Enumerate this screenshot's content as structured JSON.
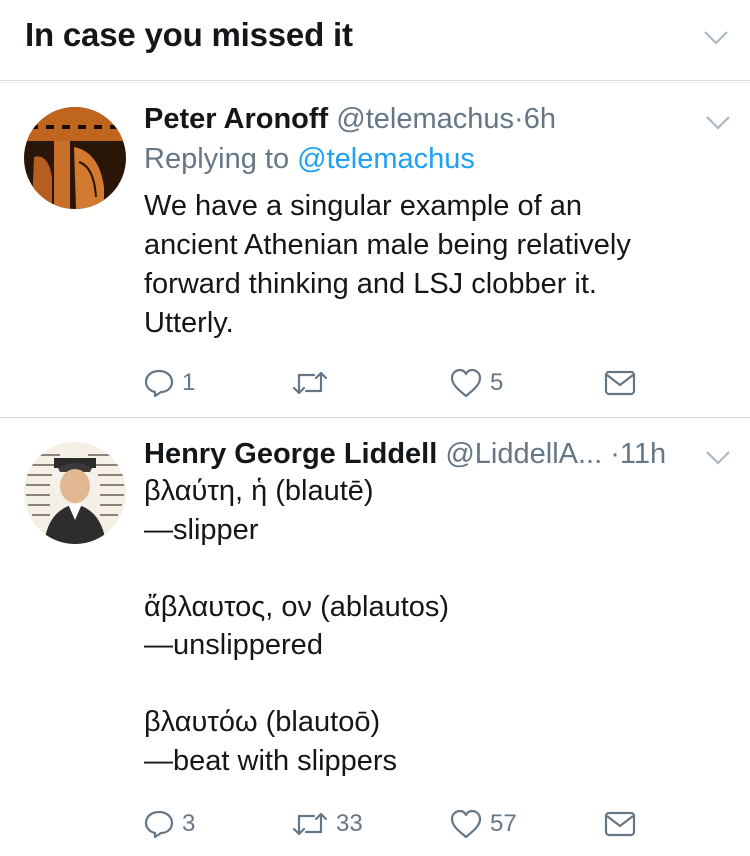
{
  "header": {
    "title": "In case you missed it"
  },
  "tweets": [
    {
      "name": "Peter Aronoff",
      "handle": "@telemachus",
      "dot": "·",
      "time": "6h",
      "reply_prefix": "Replying to",
      "reply_mention": "@telemachus",
      "text": "We have a singular example of an\nancient Athenian male being relatively\nforward thinking and LSJ clobber it.\nUtterly.",
      "replies": "1",
      "retweets": "",
      "likes": "5"
    },
    {
      "name": "Henry George Liddell",
      "handle": "@LiddellA...",
      "dot": "·",
      "time": "11h",
      "text": "βλαύτη, ἡ (blautē)\n—slipper\n\nἄβλαυτος, ον (ablautos)\n—unslippered\n\nβλαυτόω (blautoō)\n—beat with slippers",
      "replies": "3",
      "retweets": "33",
      "likes": "57"
    }
  ]
}
